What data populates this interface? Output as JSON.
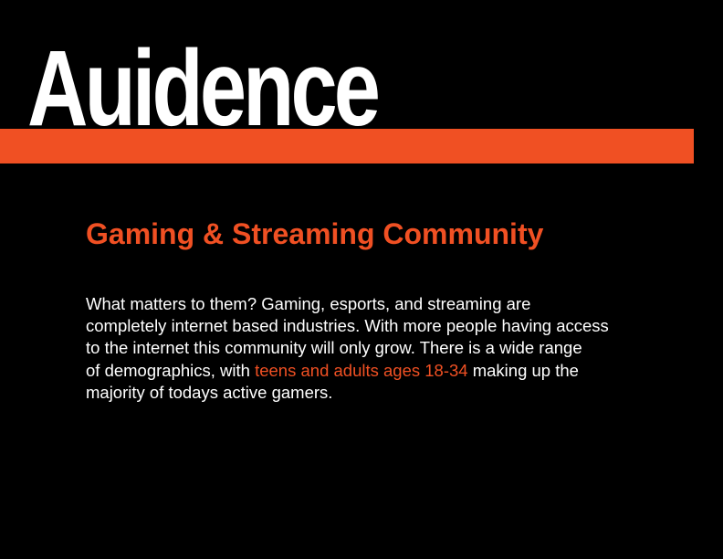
{
  "page": {
    "title": "Auidence",
    "subtitle": "Gaming & Streaming Community",
    "body": {
      "line1": "What matters to them? Gaming, esports, and streaming are",
      "line2": "completely internet based industries. With more people having access",
      "line3": "to the internet this community will only grow. There is a wide range",
      "line4_before": "of demographics, with ",
      "line4_highlight": "teens and adults ages 18-34",
      "line4_after": " making up the",
      "line5": "majority of todays active gamers."
    }
  },
  "colors": {
    "background": "#000000",
    "accent": "#f05023",
    "text": "#ffffff"
  }
}
